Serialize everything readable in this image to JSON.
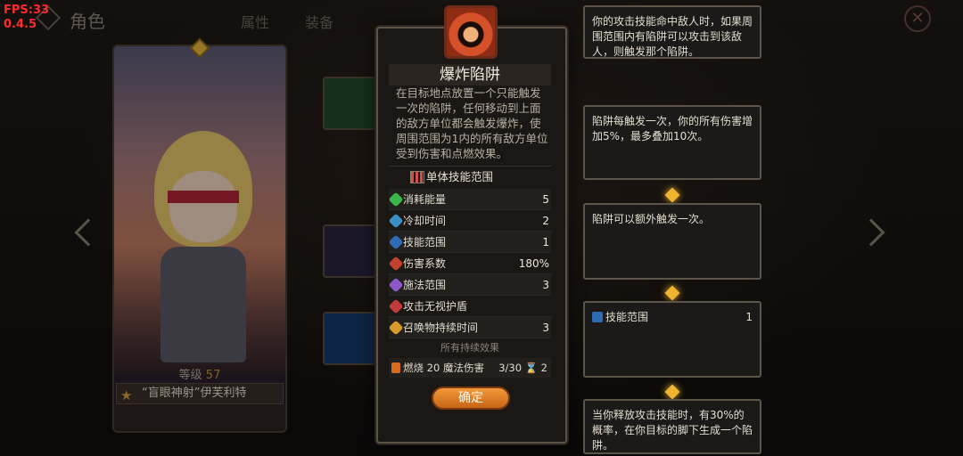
{
  "fps": "FPS:33",
  "version": "0.4.5",
  "page_title": "角色",
  "tabs": [
    "属性",
    "装备"
  ],
  "close_symbol": "✕",
  "character": {
    "level_label": "等级",
    "level_value": "57",
    "name": "“盲眼神射”伊芙利特"
  },
  "skill": {
    "title": "爆炸陷阱",
    "description": "在目标地点放置一个只能触发一次的陷阱，任何移动到上面的敌方单位都会触发爆炸，使周围范围为1内的所有敌方单位受到伤害和点燃效果。",
    "range_type": "单体技能范围",
    "stats": [
      {
        "label": "消耗能量",
        "value": "5",
        "color": "#3bb54a"
      },
      {
        "label": "冷却时间",
        "value": "2",
        "color": "#3a8fc4"
      },
      {
        "label": "技能范围",
        "value": "1",
        "color": "#2f6bb4"
      },
      {
        "label": "伤害系数",
        "value": "180%",
        "color": "#c2402e"
      },
      {
        "label": "施法范围",
        "value": "3",
        "color": "#8a58c8"
      },
      {
        "label": "攻击无视护盾",
        "value": "",
        "color": "#c23a3a"
      },
      {
        "label": "召唤物持续时间",
        "value": "3",
        "color": "#d89a2a"
      }
    ],
    "continuous_title": "所有持续效果",
    "continuous": {
      "label": "燃烧 20 魔法伤害",
      "value": "3/30 ⌛ 2"
    },
    "confirm_label": "确定"
  },
  "tips": [
    {
      "text": "你的攻击技能命中敌人时，如果周围范围内有陷阱可以攻击到该敌人，则触发那个陷阱。"
    },
    {
      "text": "陷阱每触发一次，你的所有伤害增加5%，最多叠加10次。"
    },
    {
      "text": "陷阱可以额外触发一次。"
    },
    {
      "text": "技能范围",
      "value": "1"
    },
    {
      "text": "当你释放攻击技能时，有30%的概率，在你目标的脚下生成一个陷阱。"
    }
  ]
}
